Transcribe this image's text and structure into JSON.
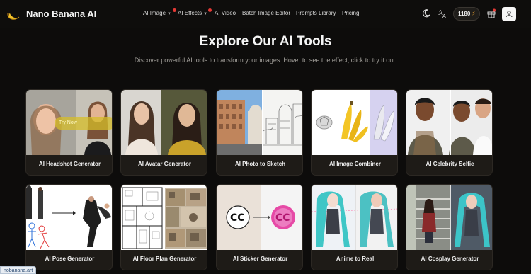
{
  "header": {
    "brand": "Nano Banana AI",
    "nav": [
      {
        "label": "AI Image",
        "dropdown": true,
        "dot": false
      },
      {
        "label": "AI Effects",
        "dropdown": true,
        "dot": true
      },
      {
        "label": "AI Video",
        "dropdown": false,
        "dot": true
      },
      {
        "label": "Batch Image Editor",
        "dropdown": false,
        "dot": false
      },
      {
        "label": "Prompts Library",
        "dropdown": false,
        "dot": false
      },
      {
        "label": "Pricing",
        "dropdown": false,
        "dot": false
      }
    ],
    "icons": [
      "moon-icon",
      "translate-icon",
      "gift-icon",
      "user-icon"
    ],
    "credits": "1180"
  },
  "hero": {
    "title": "Explore Our AI Tools",
    "subtitle": "Discover powerful AI tools to transform your images. Hover to see the effect, click to try it out."
  },
  "tools": [
    {
      "label": "AI Headshot Generator",
      "overlay": "Try Now"
    },
    {
      "label": "AI Avatar Generator"
    },
    {
      "label": "AI Photo to Sketch"
    },
    {
      "label": "AI Image Combiner"
    },
    {
      "label": "AI Celebrity Selfie"
    },
    {
      "label": "AI Pose Generator"
    },
    {
      "label": "AI Floor Plan Generator"
    },
    {
      "label": "AI Sticker Generator"
    },
    {
      "label": "Anime to Real"
    },
    {
      "label": "AI Cosplay Generator"
    }
  ],
  "status_url": "nobanana.art",
  "colors": {
    "background": "#0d0c0b",
    "card": "#1e1b17",
    "accent_bolt": "#f1a530",
    "notification_dot": "#e53935"
  }
}
